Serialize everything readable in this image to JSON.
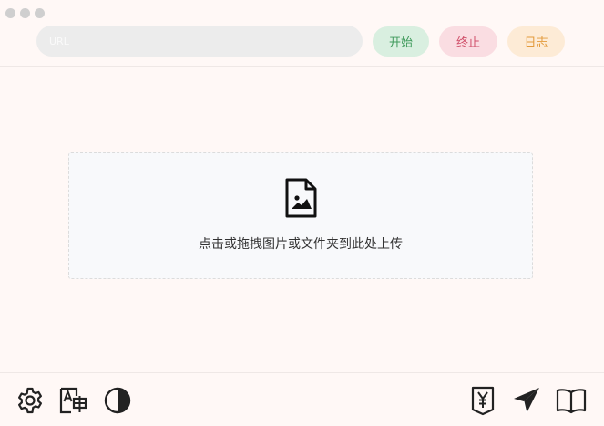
{
  "toolbar": {
    "url_placeholder": "URL",
    "start_label": "开始",
    "stop_label": "终止",
    "log_label": "日志"
  },
  "dropzone": {
    "icon": "file-image-icon",
    "hint": "点击或拖拽图片或文件夹到此处上传"
  },
  "bottom_icons": {
    "left": [
      "gear-icon",
      "translate-icon",
      "contrast-icon"
    ],
    "right": [
      "yen-icon",
      "send-icon",
      "book-icon"
    ]
  },
  "colors": {
    "background": "#fff8f6",
    "start_bg": "#d9efe0",
    "start_fg": "#3f9a5b",
    "stop_bg": "#fadde2",
    "stop_fg": "#d0506a",
    "log_bg": "#fdebd6",
    "log_fg": "#e39b3c"
  }
}
